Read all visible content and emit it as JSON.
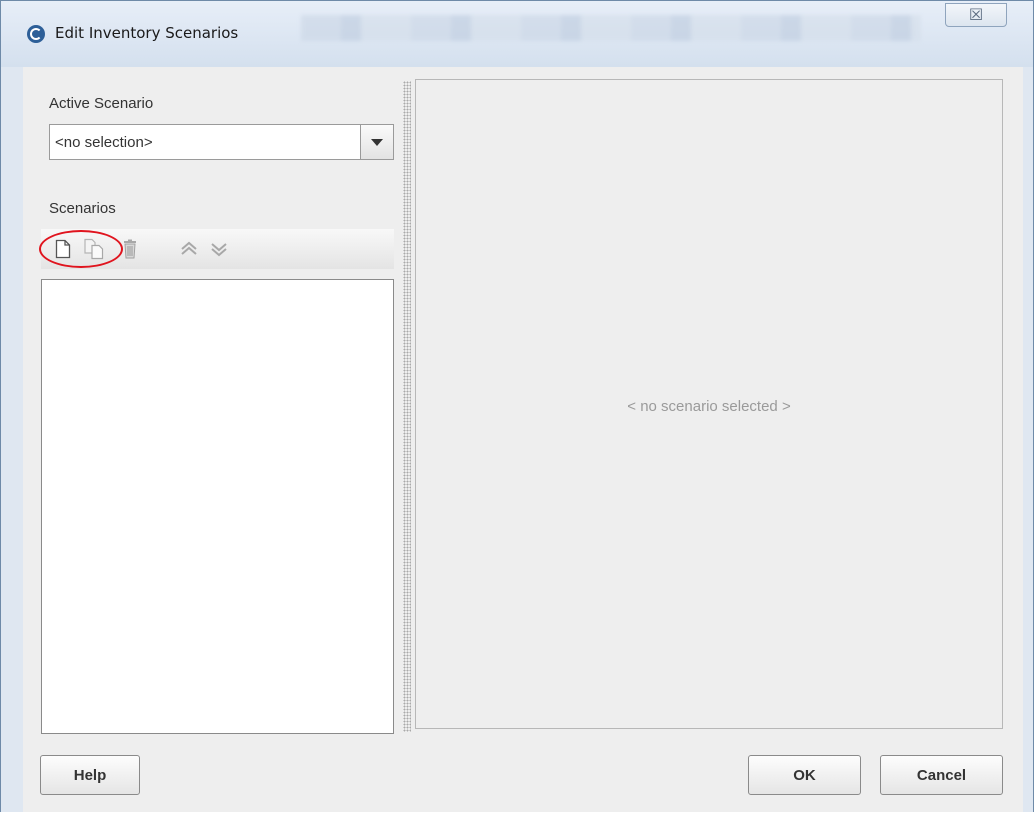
{
  "window": {
    "title": "Edit Inventory Scenarios",
    "close_glyph": "☒"
  },
  "left_panel": {
    "active_scenario_label": "Active Scenario",
    "active_scenario_value": "<no selection>",
    "scenarios_label": "Scenarios",
    "toolbar": [
      {
        "name": "new-scenario-icon",
        "tooltip_icon": "new-document-icon"
      },
      {
        "name": "copy-scenario-icon",
        "tooltip_icon": "copy-document-icon"
      },
      {
        "name": "delete-scenario-icon",
        "tooltip_icon": "trash-icon"
      },
      {
        "name": "move-up-icon",
        "tooltip_icon": "double-chevron-up-icon"
      },
      {
        "name": "move-down-icon",
        "tooltip_icon": "double-chevron-down-icon"
      }
    ],
    "scenarios": []
  },
  "right_panel": {
    "placeholder": "< no scenario selected >"
  },
  "buttons": {
    "help": "Help",
    "ok": "OK",
    "cancel": "Cancel"
  },
  "colors": {
    "highlight_circle": "#e0141e",
    "panel_bg": "#eeeeee",
    "placeholder_text": "#9a9a9a"
  }
}
